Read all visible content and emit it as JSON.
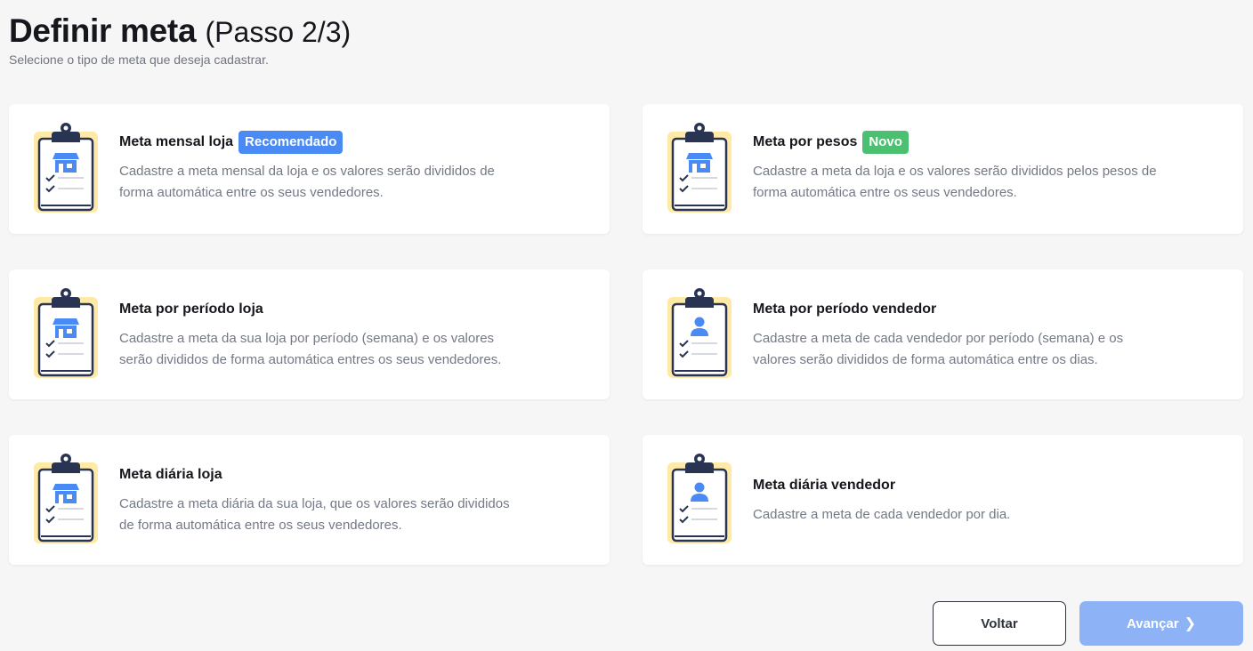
{
  "header": {
    "title": "Definir meta",
    "step": "(Passo 2/3)",
    "subtitle": "Selecione o tipo de meta que deseja cadastrar."
  },
  "cards": [
    {
      "title": "Meta mensal loja",
      "badge": "Recomendado",
      "badge_color": "#4a8af4",
      "icon": "clipboard-store-icon",
      "description_line1": "Cadastre a meta mensal da loja e os valores serão divididos de",
      "description_line2": "forma automática entre os seus vendedores."
    },
    {
      "title": "Meta por pesos",
      "badge": "Novo",
      "badge_color": "#4cc071",
      "icon": "clipboard-store-icon",
      "description_line1": "Cadastre a meta da loja e os valores serão divididos pelos pesos de",
      "description_line2": "forma automática entre os seus vendedores."
    },
    {
      "title": "Meta por período loja",
      "icon": "clipboard-store-icon",
      "description_line1": "Cadastre a meta da sua loja por período (semana) e os valores",
      "description_line2": "serão divididos de forma automática entres os seus vendedores."
    },
    {
      "title": "Meta por período vendedor",
      "icon": "clipboard-person-icon",
      "description_line1": "Cadastre a meta de cada vendedor por período (semana) e os",
      "description_line2": "valores serão divididos de forma automática entre os dias."
    },
    {
      "title": "Meta diária loja",
      "icon": "clipboard-store-icon",
      "description_line1": "Cadastre a meta diária da sua loja, que os valores serão divididos",
      "description_line2": "de forma automática entre os seus vendedores."
    },
    {
      "title": "Meta diária vendedor",
      "icon": "clipboard-person-icon",
      "description_line1": "Cadastre a meta de cada vendedor por dia."
    }
  ],
  "footer": {
    "back_label": "Voltar",
    "next_label": "Avançar",
    "next_icon": "chevron-right-icon"
  },
  "colors": {
    "clipboard_paper": "#ffe9a6",
    "clipboard_outline": "#283452",
    "store_icon": "#4a8af4",
    "next_button": "#8db3f6"
  }
}
